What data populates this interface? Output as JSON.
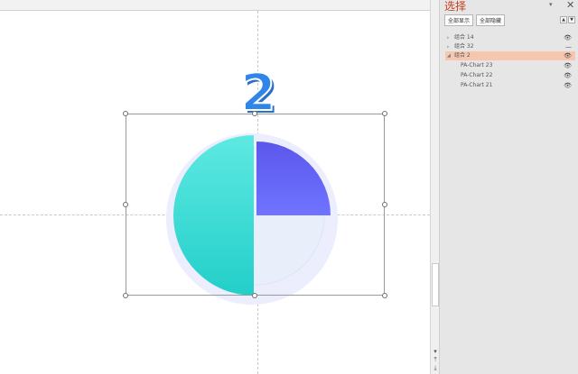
{
  "slide": {
    "big_number": "2"
  },
  "selection_pane": {
    "title": "选择",
    "show_all_label": "全部显示",
    "hide_all_label": "全部隐藏",
    "bring_forward_label": "▲",
    "send_backward_label": "▼",
    "dropdown_label": "▾",
    "close_label": "✕",
    "items": [
      {
        "label": "组合 14",
        "twisty": "▹",
        "eye": "👁"
      },
      {
        "label": "组合 32",
        "twisty": "▹",
        "eye": "—"
      },
      {
        "label": "组合 2",
        "twisty": "◢",
        "eye": "👁"
      },
      {
        "label": "PA-Chart 23",
        "twisty": "",
        "eye": "👁"
      },
      {
        "label": "PA-Chart 22",
        "twisty": "",
        "eye": "👁"
      },
      {
        "label": "PA-Chart 21",
        "twisty": "",
        "eye": "👁"
      }
    ]
  },
  "scrollbar": {
    "down_label": "▾",
    "page_up_label": "⤒",
    "page_down_label": "⤓"
  },
  "colors": {
    "accent_title": "#c43e1c",
    "number_blue": "#2f86e8",
    "teal": "#3ddcd6",
    "purple": "#5a5cf2",
    "selected_row": "#f7c6ae"
  }
}
